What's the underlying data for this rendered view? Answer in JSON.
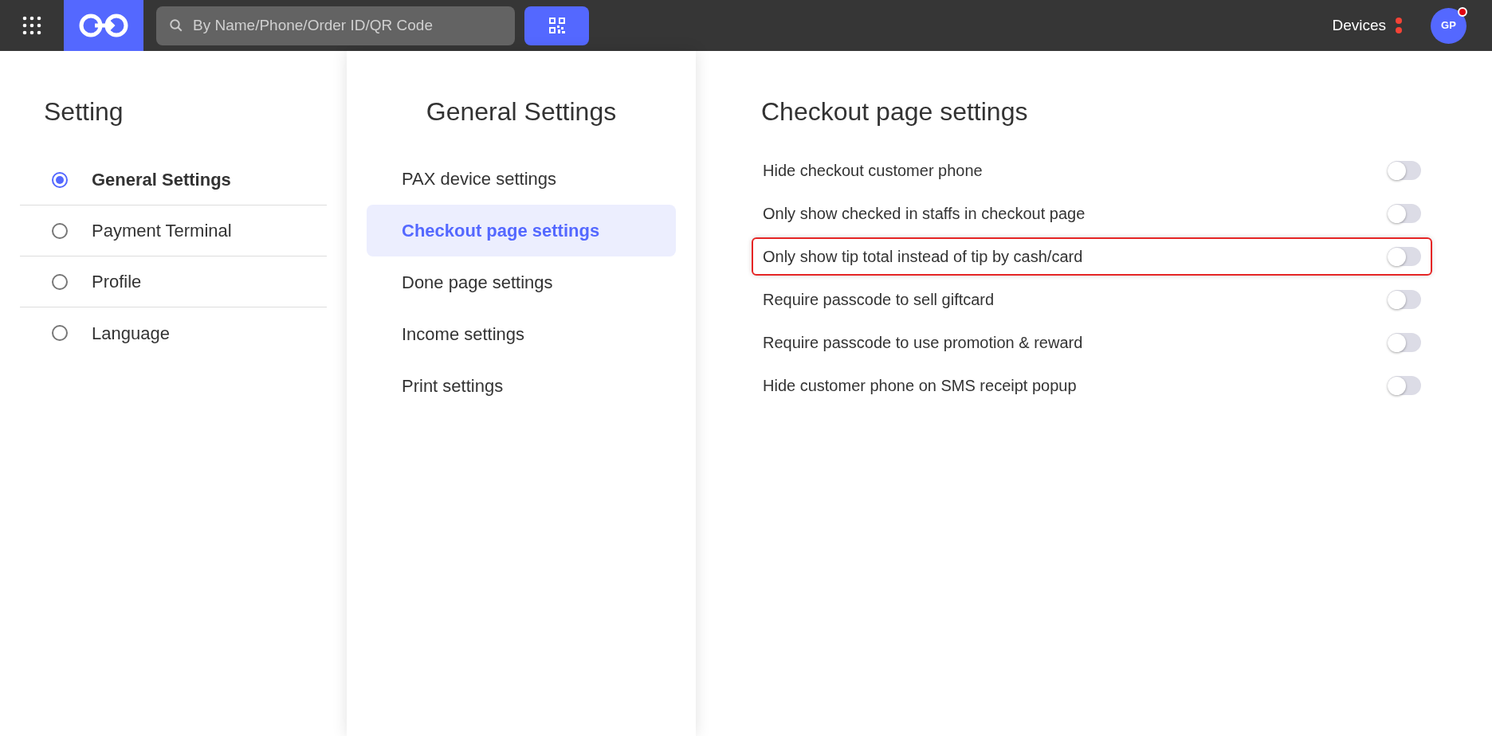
{
  "topbar": {
    "search": {
      "placeholder": "By Name/Phone/Order ID/QR Code"
    },
    "devices": "Devices",
    "avatar": "GP",
    "avatar_alert": true
  },
  "sidebar": {
    "title": "Setting",
    "items": [
      {
        "label": "General Settings",
        "selected": true
      },
      {
        "label": "Payment Terminal",
        "selected": false
      },
      {
        "label": "Profile",
        "selected": false
      },
      {
        "label": "Language",
        "selected": false
      }
    ]
  },
  "submenu": {
    "title": "General Settings",
    "items": [
      {
        "label": "PAX device settings",
        "selected": false
      },
      {
        "label": "Checkout page settings",
        "selected": true
      },
      {
        "label": "Done page settings",
        "selected": false
      },
      {
        "label": "Income settings",
        "selected": false
      },
      {
        "label": "Print settings",
        "selected": false
      }
    ]
  },
  "content": {
    "title": "Checkout page settings",
    "settings": [
      {
        "label": "Hide checkout customer phone",
        "on": false,
        "highlighted": false
      },
      {
        "label": "Only show checked in staffs in checkout page",
        "on": false,
        "highlighted": false
      },
      {
        "label": "Only show tip total instead of tip by cash/card",
        "on": false,
        "highlighted": true
      },
      {
        "label": "Require passcode to sell giftcard",
        "on": false,
        "highlighted": false
      },
      {
        "label": "Require passcode to use promotion & reward",
        "on": false,
        "highlighted": false
      },
      {
        "label": "Hide customer phone on SMS receipt popup",
        "on": false,
        "highlighted": false
      }
    ]
  }
}
